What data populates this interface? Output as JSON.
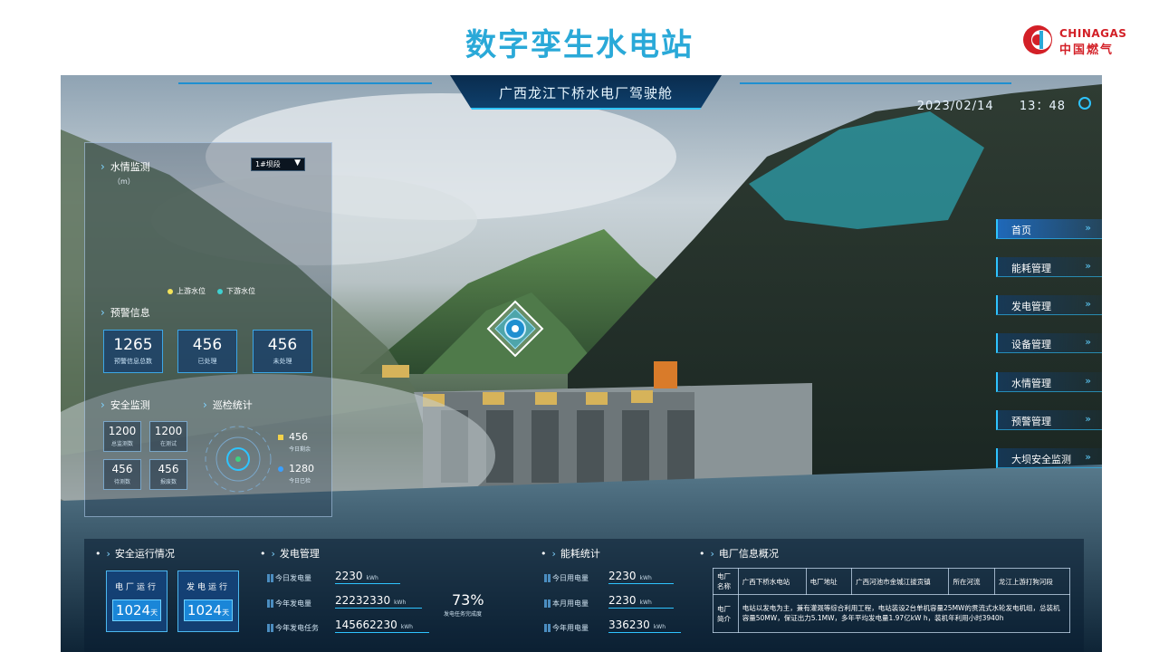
{
  "slide": {
    "title": "数字孪生水电站"
  },
  "logo": {
    "en": "CHINAGAS",
    "cn": "中国燃气"
  },
  "header": {
    "title": "广西龙江下桥水电厂驾驶舱",
    "date": "2023/02/14",
    "time": "13：48"
  },
  "water_monitor": {
    "title": "水情监测",
    "select_value": "1#坝段",
    "unit": "（m）",
    "legend_up": "上游水位",
    "legend_down": "下游水位",
    "legend_up_color": "#f3e35a",
    "legend_down_color": "#3fd0d0"
  },
  "warning": {
    "title": "预警信息",
    "stats": [
      {
        "value": "1265",
        "label": "预警信息总数"
      },
      {
        "value": "456",
        "label": "已处理"
      },
      {
        "value": "456",
        "label": "未处理"
      }
    ]
  },
  "safety": {
    "title": "安全监测",
    "boxes": [
      {
        "value": "1200",
        "label": "总监测数"
      },
      {
        "value": "1200",
        "label": "在测试"
      },
      {
        "value": "456",
        "label": "待测数"
      },
      {
        "value": "456",
        "label": "报废数"
      }
    ]
  },
  "patrol": {
    "title": "巡检统计",
    "items": [
      {
        "value": "456",
        "label": "今日剩余",
        "color": "#f3d24a"
      },
      {
        "value": "1280",
        "label": "今日已检",
        "color": "#3aa0ff"
      }
    ]
  },
  "nav": {
    "items": [
      "首页",
      "能耗管理",
      "发电管理",
      "设备管理",
      "水情管理",
      "预警管理",
      "大坝安全监测"
    ],
    "arrow": "»"
  },
  "bottom": {
    "safe_run": {
      "title": "安全运行情况",
      "boxes": [
        {
          "label": "电厂运行",
          "value": "1024",
          "unit": "天"
        },
        {
          "label": "发电运行",
          "value": "1024",
          "unit": "天"
        }
      ]
    },
    "power": {
      "title": "发电管理",
      "rows": [
        {
          "label": "今日发电量",
          "value": "2230",
          "unit": "kWh"
        },
        {
          "label": "今年发电量",
          "value": "22232330",
          "unit": "kWh"
        },
        {
          "label": "今年发电任务",
          "value": "145662230",
          "unit": "kWh"
        }
      ],
      "percent": "73%",
      "percent_label": "发电任务完成度"
    },
    "energy": {
      "title": "能耗统计",
      "rows": [
        {
          "label": "今日用电量",
          "value": "2230",
          "unit": "kWh"
        },
        {
          "label": "本月用电量",
          "value": "2230",
          "unit": "kWh"
        },
        {
          "label": "今年用电量",
          "value": "336230",
          "unit": "kWh"
        }
      ]
    },
    "plant": {
      "title": "电厂信息概况",
      "name_label": "电厂名称",
      "name_value": "广西下桥水电站",
      "addr_label": "电厂地址",
      "addr_value": "广西河池市金城江拔贡镇",
      "river_label": "所在河流",
      "river_value": "龙江上游打狗河段",
      "intro_label": "电厂简介",
      "intro_value": "电站以发电为主，兼有灌溉等综合利用工程，电站装设2台单机容量25MW的贯流式水轮发电机组，总装机容量50MW，保证出力5.1MW，多年平均发电量1.97亿kW h，装机年利用小时3940h"
    }
  }
}
